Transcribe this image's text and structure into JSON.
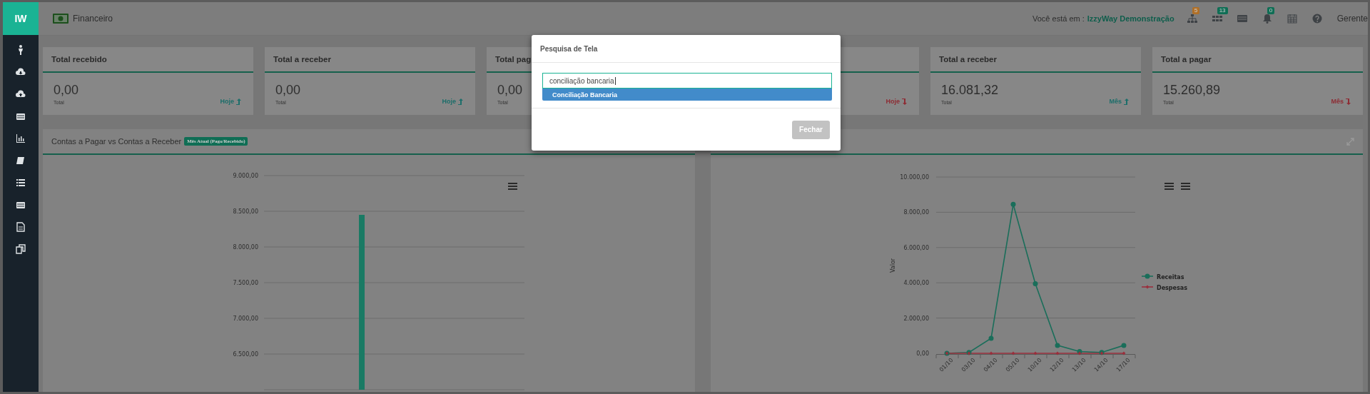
{
  "sidebar": {
    "logo": "IW"
  },
  "header": {
    "title": "Financeiro",
    "location_label": "Você está em :",
    "location": "IzzyWay Demonstração",
    "icons": [
      {
        "kind": "sitemap",
        "badge": "5",
        "color": "#b07028"
      },
      {
        "kind": "grid",
        "badge": "13",
        "color": "#0f6e55"
      },
      {
        "kind": "list"
      },
      {
        "kind": "bell",
        "badge": "0",
        "color": "#0f6e55"
      },
      {
        "kind": "calendar"
      },
      {
        "kind": "help"
      }
    ],
    "user": "Gerente"
  },
  "cards": [
    {
      "title": "Total recebido",
      "value": "0,00",
      "caption": "Total",
      "period": "Hoje",
      "trend_up": true
    },
    {
      "title": "Total a receber",
      "value": "0,00",
      "caption": "Total",
      "period": "Hoje",
      "trend_up": true
    },
    {
      "title": "Total pag",
      "value": "0,00",
      "caption": "Total"
    },
    {
      "period": "Hoje",
      "trend_up": false
    },
    {
      "title": "Total a receber",
      "value": "16.081,32",
      "caption": "Total",
      "period": "Mês",
      "trend_up": true
    },
    {
      "title": "Total a pagar",
      "value": "15.260,89",
      "caption": "Total",
      "period": "Mês",
      "trend_up": false
    }
  ],
  "panels": [
    {
      "title": "Contas a Pagar vs Contas a Receber",
      "badge": "Mês Atual (Pago/Recebido)",
      "chart_data": {
        "type": "bar",
        "grid": true,
        "values": [
          8450
        ],
        "ylim": [
          6000,
          9000
        ],
        "yticks": [
          {
            "value": 6500,
            "label": "6.500,00"
          },
          {
            "value": 7000,
            "label": "7.000,00"
          },
          {
            "value": 7500,
            "label": "7.500,00"
          },
          {
            "value": 8000,
            "label": "8.000,00"
          },
          {
            "value": 8500,
            "label": "8.500,00"
          },
          {
            "value": 9000,
            "label": "9.000,00"
          }
        ]
      }
    },
    {
      "chart_data": {
        "type": "line",
        "grid": true,
        "legend": true,
        "ylabel": "Valor",
        "categories": [
          "01/10",
          "03/10",
          "04/10",
          "05/10",
          "10/10",
          "12/10",
          "13/10",
          "14/10",
          "17/10"
        ],
        "ylim": [
          0,
          10000
        ],
        "yticks": [
          {
            "value": 0,
            "label": "0,00"
          },
          {
            "value": 2000,
            "label": "2.000,00"
          },
          {
            "value": 4000,
            "label": "4.000,00"
          },
          {
            "value": 6000,
            "label": "6.000,00"
          },
          {
            "value": 8000,
            "label": "8.000,00"
          },
          {
            "value": 10000,
            "label": "10.000,00"
          }
        ],
        "series": [
          {
            "name": "Receitas",
            "color": "#1a6e5a",
            "marker": "circle",
            "values": [
              0,
              50,
              850,
              8450,
              3950,
              450,
              100,
              50,
              450
            ]
          },
          {
            "name": "Despesas",
            "color": "#9a2f3c",
            "marker": "diamond",
            "values": [
              0,
              0,
              0,
              0,
              0,
              0,
              0,
              0,
              0
            ]
          }
        ]
      }
    }
  ],
  "modal": {
    "title": "Pesquisa de Tela",
    "query": "conciliação bancaria",
    "suggestions": [
      {
        "label": "Conciliação Bancaria",
        "selected": true
      }
    ],
    "button": "Fechar"
  }
}
